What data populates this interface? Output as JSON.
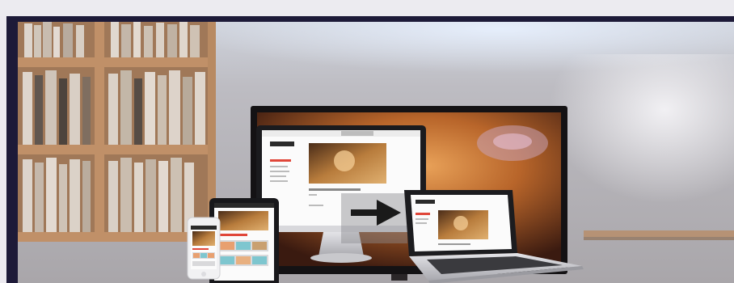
{
  "hero": {
    "shown_device_types": [
      "tv",
      "desktop-monitor",
      "tablet",
      "smartphone",
      "laptop"
    ],
    "colors": {
      "frame": "#1d1a38",
      "wall": "#b8b7bd",
      "shelf_wood": "#a07550",
      "tv_glow": "#c0702c",
      "screen_accent": "#e0473a"
    },
    "icons": [
      "play-arrow-icon"
    ]
  }
}
